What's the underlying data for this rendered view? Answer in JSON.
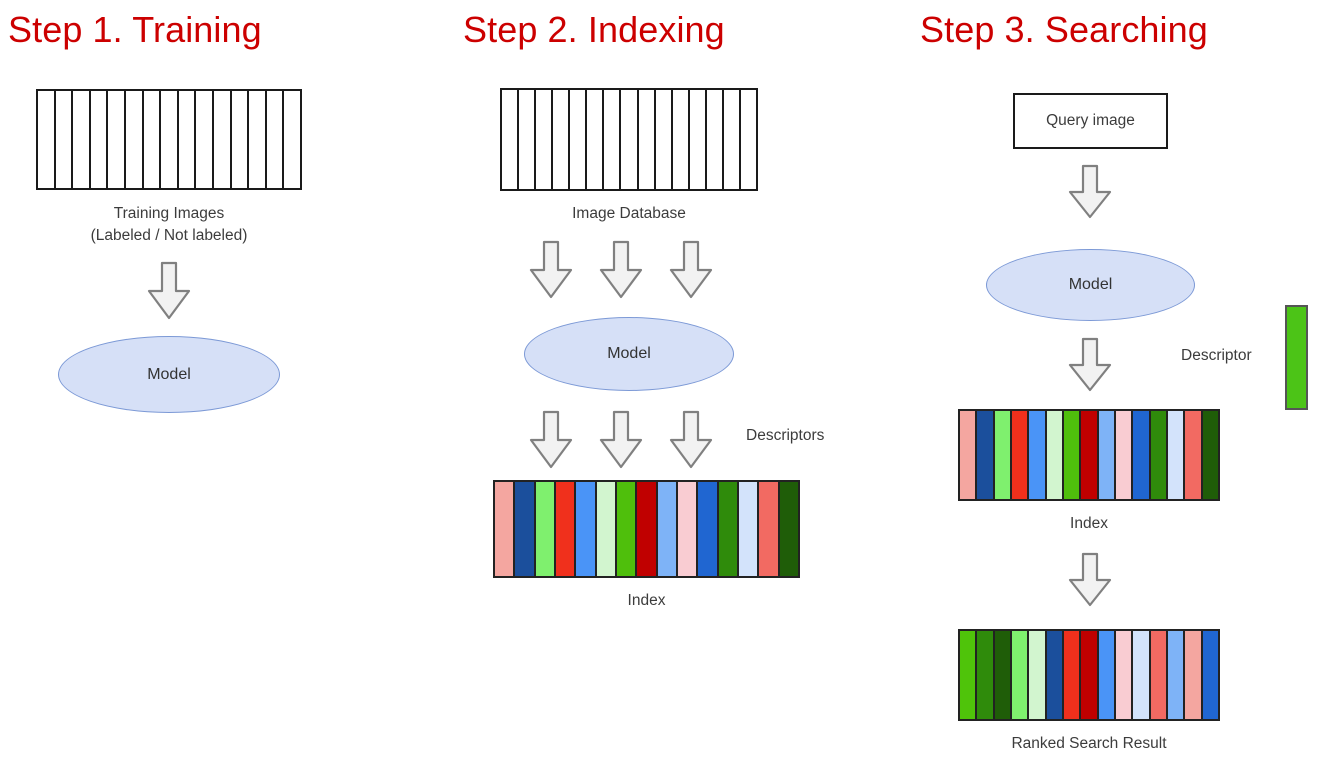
{
  "steps": [
    {
      "title": "Step 1. Training",
      "strip_label_line1": "Training Images",
      "strip_label_line2": "(Labeled / Not labeled)",
      "model_label": "Model"
    },
    {
      "title": "Step 2. Indexing",
      "strip_label": "Image Database",
      "model_label": "Model",
      "descriptors_label": "Descriptors",
      "index_label": "Index"
    },
    {
      "title": "Step 3. Searching",
      "query_box_label": "Query image",
      "model_label": "Model",
      "descriptor_label": "Descriptor",
      "index_label": "Index",
      "result_label": "Ranked Search Result"
    }
  ],
  "colors": {
    "title_red": "#cc0000",
    "ellipse_fill": "#d6e0f7",
    "ellipse_stroke": "#7c99d6",
    "arrow_fill": "#f2f2f2",
    "arrow_stroke": "#808080",
    "outline_black": "#1a1a1a",
    "text_gray": "#3c3c3c",
    "descriptor_green": "#4cc417"
  },
  "film_strip_cells": 15,
  "index_colors": [
    "#f4a6a0",
    "#1b4f9c",
    "#7ff06e",
    "#f0301c",
    "#4a94f7",
    "#d2f5cf",
    "#4fbf0c",
    "#c00000",
    "#7eb3f7",
    "#f9ccd2",
    "#2066d1",
    "#2f8b0b",
    "#d3e3fb",
    "#f26a62",
    "#1f5d08"
  ],
  "search_index_colors": [
    "#f4a6a0",
    "#1b4f9c",
    "#7ff06e",
    "#f0301c",
    "#4a94f7",
    "#d2f5cf",
    "#4fbf0c",
    "#c00000",
    "#7eb3f7",
    "#f9ccd2",
    "#2066d1",
    "#2f8b0b",
    "#d3e3fb",
    "#f26a62",
    "#1f5d08"
  ],
  "ranked_result_colors": [
    "#4fc40a",
    "#2f8b0b",
    "#1f5d08",
    "#7ff06e",
    "#d2f5cf",
    "#1b4f9c",
    "#f0301c",
    "#c00000",
    "#4a94f7",
    "#f9ccd2",
    "#d3e3fb",
    "#f26a62",
    "#7eb3f7",
    "#f4a6a0",
    "#2066d1"
  ]
}
